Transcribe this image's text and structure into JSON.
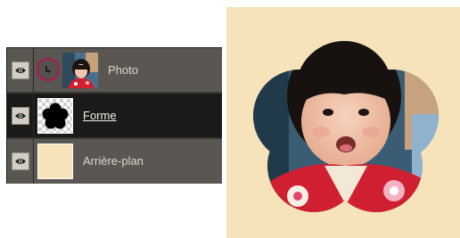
{
  "layers_panel": {
    "layers": [
      {
        "name": "Photo",
        "selected": false,
        "visible": true,
        "clipped": true,
        "thumb": "child-photo"
      },
      {
        "name": "Forme",
        "selected": true,
        "visible": true,
        "thumb": "flower-shape-on-transparency"
      },
      {
        "name": "Arrière-plan",
        "selected": false,
        "visible": true,
        "thumb": "solid-beige"
      }
    ],
    "icons": {
      "visibility": "eye-icon",
      "clipping": "clipping-mask-arrow-icon"
    }
  },
  "colors": {
    "panel_bg": "#5a5752",
    "selected_row_bg": "#1c1a19",
    "highlight_circle": "#b01455",
    "background_fill": "#f6e3b9"
  },
  "preview": {
    "shape": "flower-clipping-mask",
    "content": "child-photo"
  }
}
